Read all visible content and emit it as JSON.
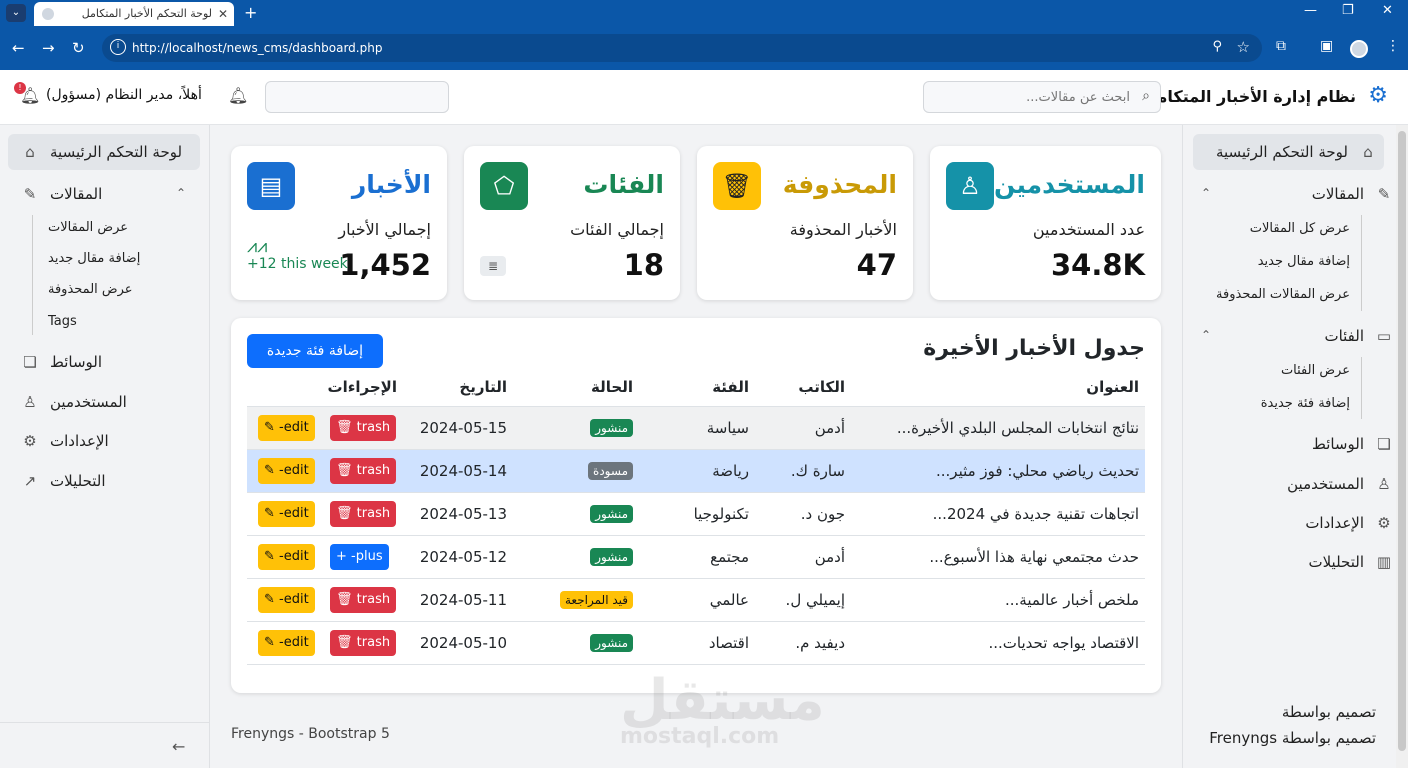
{
  "browser": {
    "tab_title": "لوحة التحكم الأخبار المتكامل",
    "url": "http://localhost/news_cms/dashboard.php"
  },
  "header": {
    "brand": "نظام إدارة الأخبار المتكامل",
    "search_placeholder": "ابحث عن مقالات...",
    "greeting": "أهلاً، مدير النظام (مسؤول)",
    "notification_count": "!"
  },
  "left_sidebar": {
    "dashboard": "لوحة التحكم الرئيسية",
    "articles": "المقالات",
    "articles_sub": [
      "عرض المقالات",
      "إضافة مقال جديد",
      "عرض المحذوفة",
      "Tags"
    ],
    "media": "الوسائط",
    "users": "المستخدمين",
    "settings": "الإعدادات",
    "analytics": "التحليلات"
  },
  "right_sidebar": {
    "dashboard": "لوحة التحكم الرئيسية",
    "articles": "المقالات",
    "articles_sub": [
      "عرض كل المقالات",
      "إضافة مقال جديد",
      "عرض المقالات المحذوفة"
    ],
    "categories": "الفئات",
    "categories_sub": [
      "عرض الفئات",
      "إضافة فئة جديدة"
    ],
    "media": "الوسائط",
    "users": "المستخدمين",
    "settings": "الإعدادات",
    "analytics": "التحليلات",
    "footer1": "تصميم بواسطة",
    "footer2_name": "Frenyngs",
    "footer2": "تصميم بواسطة"
  },
  "cards": {
    "news": {
      "title": "الأخبار",
      "label": "إجمالي الأخبار",
      "value": "1,452",
      "trend": "+12 this week",
      "color": "#1a6fd1"
    },
    "categories": {
      "title": "الفئات",
      "label": "إجمالي الفئات",
      "value": "18",
      "color": "#198754"
    },
    "deleted": {
      "title": "المحذوفة",
      "label": "الأخبار المحذوفة",
      "value": "47",
      "color": "#c99a06"
    },
    "users": {
      "title": "المستخدمين",
      "label": "عدد المستخدمين",
      "value": "34.8K",
      "color": "#1592a8"
    }
  },
  "table": {
    "title": "جدول الأخبار الأخيرة",
    "add_button": "إضافة فئة جديدة",
    "headers": {
      "title": "العنوان",
      "author": "الكاتب",
      "category": "الفئة",
      "status": "الحالة",
      "date": "التاريخ",
      "actions": "الإجراءات"
    },
    "rows": [
      {
        "title": "نتائج انتخابات المجلس البلدي الأخيرة...",
        "author": "أدمن",
        "category": "سياسة",
        "status": "منشور",
        "date": "2024-05-15",
        "action1": "trash",
        "action2": "-edit"
      },
      {
        "title": "تحديث رياضي محلي: فوز مثير...",
        "author": "سارة ك.",
        "category": "رياضة",
        "status": "مسودة",
        "date": "2024-05-14",
        "action1": "trash",
        "action2": "-edit"
      },
      {
        "title": "اتجاهات تقنية جديدة في 2024...",
        "author": "جون د.",
        "category": "تكنولوجيا",
        "status": "منشور",
        "date": "2024-05-13",
        "action1": "trash",
        "action2": "-edit"
      },
      {
        "title": "حدث مجتمعي نهاية هذا الأسبوع...",
        "author": "أدمن",
        "category": "مجتمع",
        "status": "منشور",
        "date": "2024-05-12",
        "action1": "-plus",
        "action2": "-edit"
      },
      {
        "title": "ملخص أخبار عالمية...",
        "author": "إيميلي ل.",
        "category": "عالمي",
        "status": "قيد المراجعة",
        "date": "2024-05-11",
        "action1": "trash",
        "action2": "-edit"
      },
      {
        "title": "الاقتصاد يواجه تحديات...",
        "author": "ديفيد م.",
        "category": "اقتصاد",
        "status": "منشور",
        "date": "2024-05-10",
        "action1": "trash",
        "action2": "-edit"
      }
    ]
  },
  "footer": {
    "credit": "Frenyngs - Bootstrap 5"
  },
  "watermark": {
    "main": "مستقل",
    "sub": "mostaql.com"
  }
}
